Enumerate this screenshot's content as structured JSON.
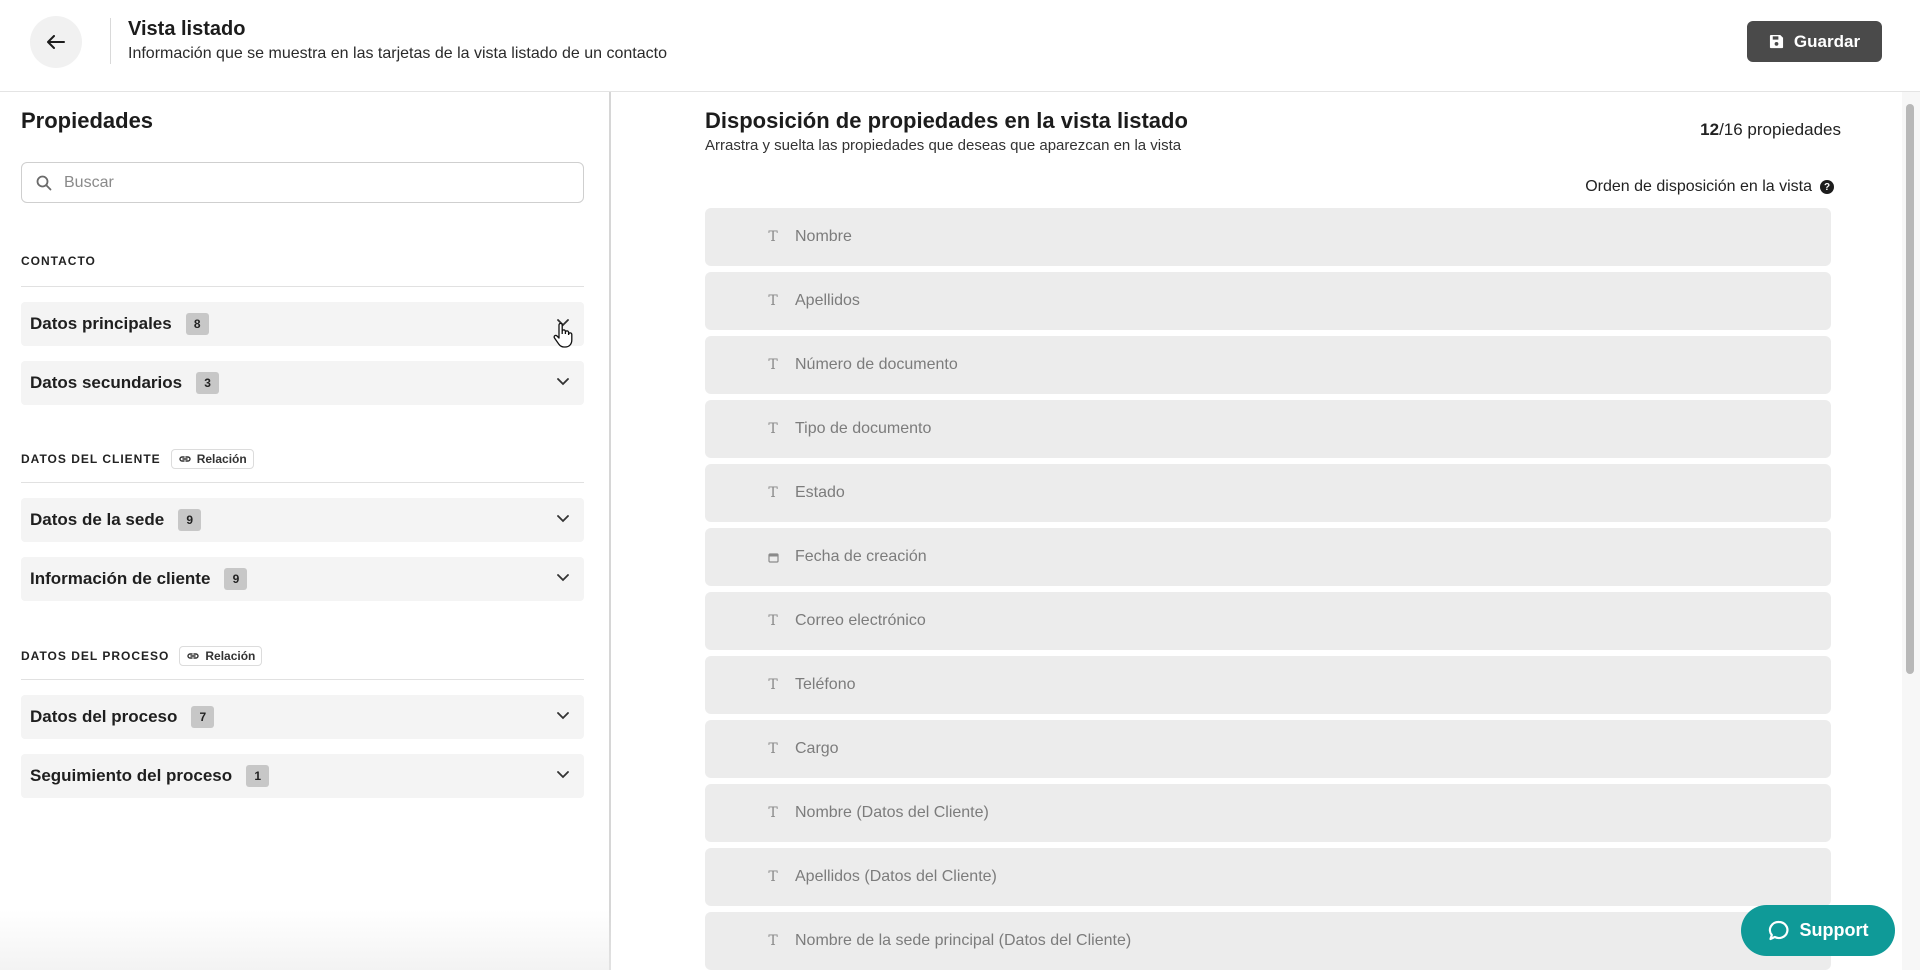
{
  "header": {
    "title": "Vista listado",
    "subtitle": "Información que se muestra en las tarjetas de la vista listado de un contacto",
    "save_label": "Guardar"
  },
  "left": {
    "title": "Propiedades",
    "search_placeholder": "Buscar",
    "sections": [
      {
        "label": "CONTACTO",
        "relation": "",
        "groups": [
          {
            "label": "Datos principales",
            "count": "8"
          },
          {
            "label": "Datos secundarios",
            "count": "3"
          }
        ]
      },
      {
        "label": "DATOS DEL CLIENTE",
        "relation": "Relación",
        "groups": [
          {
            "label": "Datos de la sede",
            "count": "9"
          },
          {
            "label": "Información de cliente",
            "count": "9"
          }
        ]
      },
      {
        "label": "DATOS DEL PROCESO",
        "relation": "Relación",
        "groups": [
          {
            "label": "Datos del proceso",
            "count": "7"
          },
          {
            "label": "Seguimiento del proceso",
            "count": "1"
          }
        ]
      }
    ]
  },
  "right": {
    "title": "Disposición de propiedades en la vista listado",
    "subtitle": "Arrastra y suelta las propiedades que deseas que aparezcan en la vista",
    "count_selected": "12",
    "count_total": "/16 propiedades",
    "order_label": "Orden de disposición en la vista",
    "properties": [
      {
        "type": "text-icon",
        "label": "Nombre"
      },
      {
        "type": "text-icon",
        "label": "Apellidos"
      },
      {
        "type": "text-icon",
        "label": "Número de documento"
      },
      {
        "type": "text-icon",
        "label": "Tipo de documento"
      },
      {
        "type": "text-icon",
        "label": "Estado"
      },
      {
        "type": "calendar-icon",
        "label": "Fecha de creación"
      },
      {
        "type": "text-icon",
        "label": "Correo electrónico"
      },
      {
        "type": "text-icon",
        "label": "Teléfono"
      },
      {
        "type": "text-icon",
        "label": "Cargo"
      },
      {
        "type": "text-icon",
        "label": "Nombre (Datos del Cliente)"
      },
      {
        "type": "text-icon",
        "label": "Apellidos (Datos del Cliente)"
      },
      {
        "type": "text-icon",
        "label": "Nombre de la sede principal (Datos del Cliente)"
      }
    ]
  },
  "support_label": "Support",
  "colors": {
    "save_button": "#4a4a4a",
    "support_button": "#0f9a98",
    "row_background": "#ececec",
    "badge_background": "#c7c7c7"
  }
}
